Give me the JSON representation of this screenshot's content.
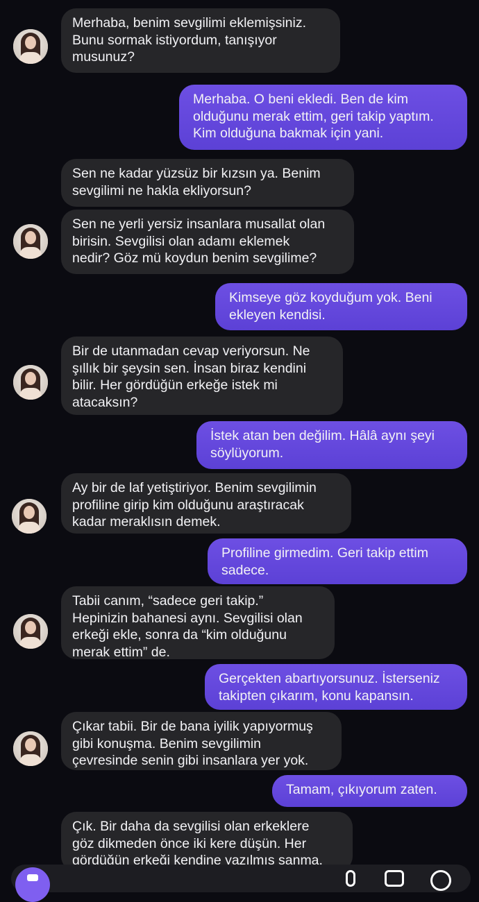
{
  "messages": [
    {
      "side": "in",
      "text": "Merhaba, benim sevgilimi eklemişsiniz.\nBunu sormak istiyordum, tanışıyor\nmusunuz?"
    },
    {
      "side": "out",
      "text": "Merhaba. O beni ekledi. Ben de kim\nolduğunu merak ettim, geri takip yaptım.\nKim olduğuna bakmak için yani."
    },
    {
      "side": "in",
      "text": "Sen ne kadar yüzsüz bir kızsın ya. Benim\nsevgilimi ne hakla ekliyorsun?"
    },
    {
      "side": "in",
      "text": "Sen ne yerli yersiz insanlara musallat olan\nbirisin. Sevgilisi olan adamı eklemek\nnedir? Göz mü koydun benim sevgilime?"
    },
    {
      "side": "out",
      "text": "Kimseye göz koyduğum yok. Beni\nekleyen kendisi."
    },
    {
      "side": "in",
      "text": "Bir de utanmadan cevap veriyorsun. Ne\nşıllık bir şeysin sen. İnsan biraz kendini\nbilir. Her gördüğün erkeğe istek mi\natacaksın?"
    },
    {
      "side": "out",
      "text": "İstek atan ben değilim. Hâlâ aynı şeyi\nsöylüyorum."
    },
    {
      "side": "in",
      "text": "Ay bir de laf yetiştiriyor. Benim sevgilimin\nprofiline girip kim olduğunu araştıracak\nkadar meraklısın demek."
    },
    {
      "side": "out",
      "text": "Profiline girmedim. Geri takip ettim\nsadece."
    },
    {
      "side": "in",
      "text": "Tabii canım, “sadece geri takip.”\nHepinizin bahanesi aynı. Sevgilisi olan\nerkeği ekle, sonra da “kim olduğunu\nmerak ettim” de."
    },
    {
      "side": "out",
      "text": "Gerçekten abartıyorsunuz. İsterseniz\ntakipten çıkarım, konu kapansın."
    },
    {
      "side": "in",
      "text": "Çıkar tabii. Bir de bana iyilik yapıyormuş\ngibi konuşma. Benim sevgilimin\nçevresinde senin gibi insanlara yer yok."
    },
    {
      "side": "out",
      "text": "Tamam, çıkıyorum zaten."
    },
    {
      "side": "in",
      "text": "Çık. Bir daha da sevgilisi olan erkeklere\ngöz dikmeden önce iki kere düşün. Her\ngördüğün erkeği kendine yazılmış sanma."
    }
  ],
  "colors": {
    "background": "#0b0b11",
    "incoming_bubble": "#262629",
    "outgoing_bubble": "#6447dc",
    "text": "#f2f2f5"
  },
  "icons": {
    "avatar": "contact-avatar",
    "composer": [
      "camera-icon",
      "microphone-icon",
      "gallery-icon",
      "sticker-icon"
    ]
  }
}
